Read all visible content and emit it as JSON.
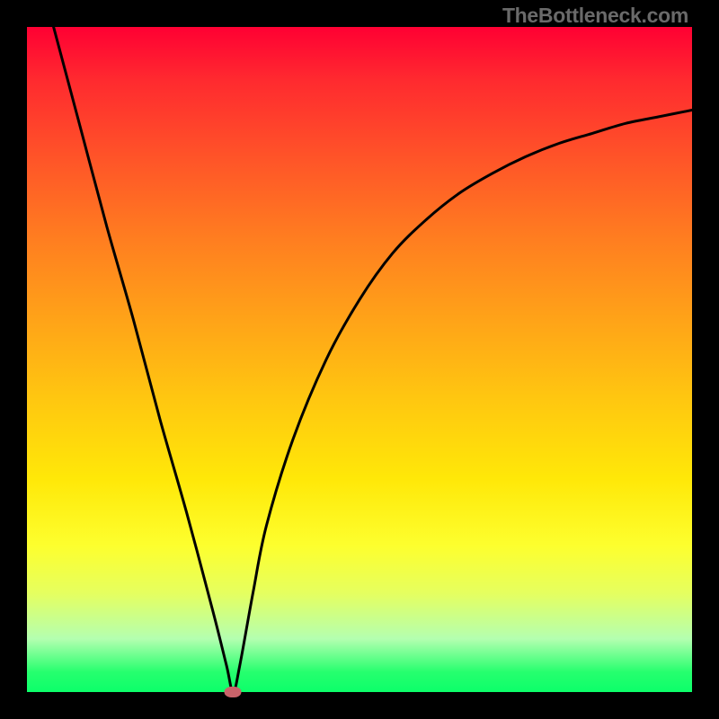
{
  "watermark": "TheBottleneck.com",
  "chart_data": {
    "type": "line",
    "title": "",
    "xlabel": "",
    "ylabel": "",
    "xlim": [
      0,
      100
    ],
    "ylim": [
      0,
      100
    ],
    "grid": false,
    "series": [
      {
        "name": "bottleneck-curve",
        "x": [
          4,
          8,
          12,
          16,
          20,
          24,
          28,
          30,
          31,
          32,
          34,
          36,
          40,
          45,
          50,
          55,
          60,
          65,
          70,
          75,
          80,
          85,
          90,
          95,
          100
        ],
        "y": [
          100,
          85,
          70,
          56,
          41,
          27,
          12,
          4,
          0,
          4,
          15,
          25,
          38,
          50,
          59,
          66,
          71,
          75,
          78,
          80.5,
          82.5,
          84,
          85.5,
          86.5,
          87.5
        ]
      }
    ],
    "annotations": [
      {
        "name": "vertex-marker",
        "x": 31,
        "y": 0,
        "shape": "ellipse",
        "color": "#c9636a"
      }
    ],
    "background_gradient": [
      "#ff0033",
      "#ffa318",
      "#fdff2e",
      "#0cff6a"
    ]
  }
}
